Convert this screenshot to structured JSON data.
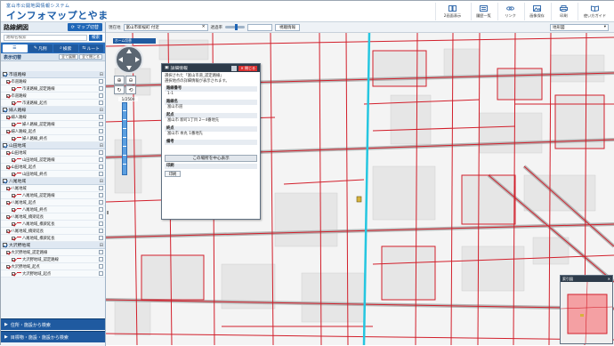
{
  "header": {
    "subtitle": "富山市公開地図情報システム",
    "title": "インフォマップとやま",
    "tools": [
      {
        "label": "2画面表示",
        "icon": "dual-screen-icon"
      },
      {
        "label": "履歴一覧",
        "icon": "history-list-icon"
      },
      {
        "label": "リンク",
        "icon": "link-icon"
      },
      {
        "label": "画像保存",
        "icon": "image-save-icon"
      },
      {
        "label": "印刷",
        "icon": "print-icon"
      },
      {
        "label": "使い方ガイド",
        "icon": "guide-icon"
      }
    ]
  },
  "panel": {
    "title": "路線網図",
    "map_switch": "マップ切替",
    "search_placeholder": "路線名検索",
    "search_button": "検索",
    "tabs": [
      "",
      "凡例",
      "検索",
      "ルート"
    ],
    "layer_bar": {
      "label": "表示切替",
      "btn_open": "全て展開",
      "btn_close": "全て閉じる"
    },
    "groups": [
      {
        "label": "市道路線",
        "checked": true,
        "items": [
          {
            "level": 1,
            "label": "市道路線",
            "checked": true
          },
          {
            "level": 2,
            "label": "市道路線_認定路線",
            "checked": true,
            "color": "#d21f2b"
          },
          {
            "level": 1,
            "label": "市道路線",
            "checked": true
          },
          {
            "level": 2,
            "label": "市道路線_起点",
            "checked": true,
            "color": "#d21f2b"
          }
        ]
      },
      {
        "label": "婦人路線",
        "checked": true,
        "items": [
          {
            "level": 1,
            "label": "婦人路線",
            "checked": true
          },
          {
            "level": 2,
            "label": "婦人路線_認定路線",
            "checked": true,
            "color": "#d21f2b"
          },
          {
            "level": 1,
            "label": "婦人路線_起点",
            "checked": true
          },
          {
            "level": 2,
            "label": "婦人路線_終点",
            "checked": true,
            "color": "#d21f2b"
          }
        ]
      },
      {
        "label": "山田地域",
        "checked": true,
        "items": [
          {
            "level": 1,
            "label": "山田地域",
            "checked": true
          },
          {
            "level": 2,
            "label": "山田地域_認定路線",
            "checked": true,
            "color": "#d21f2b"
          },
          {
            "level": 1,
            "label": "山田地域_起点",
            "checked": true
          },
          {
            "level": 2,
            "label": "山田地域_終点",
            "checked": true,
            "color": "#d21f2b"
          }
        ]
      },
      {
        "label": "八尾地域",
        "checked": true,
        "items": [
          {
            "level": 1,
            "label": "八尾地域",
            "checked": true
          },
          {
            "level": 2,
            "label": "八尾地域_認定路線",
            "checked": true,
            "color": "#d21f2b"
          },
          {
            "level": 1,
            "label": "八尾地域_起点",
            "checked": true
          },
          {
            "level": 2,
            "label": "八尾地域_終点",
            "checked": true,
            "color": "#d21f2b"
          },
          {
            "level": 1,
            "label": "八尾地域_橋梁延長",
            "checked": true
          },
          {
            "level": 2,
            "label": "八尾地域_橋梁延長",
            "checked": true,
            "color": "#d21f2b"
          },
          {
            "level": 1,
            "label": "八尾地域_橋梁延長",
            "checked": true
          },
          {
            "level": 2,
            "label": "八尾地域_橋梁延長",
            "checked": true,
            "color": "#d21f2b"
          }
        ]
      },
      {
        "label": "大沢野地域",
        "checked": true,
        "items": [
          {
            "level": 1,
            "label": "大沢野地域_認定路線",
            "checked": true
          },
          {
            "level": 2,
            "label": "大沢野地域_認定路線",
            "checked": true,
            "color": "#d21f2b"
          },
          {
            "level": 1,
            "label": "大沢野地域_起点",
            "checked": true
          },
          {
            "level": 2,
            "label": "大沢野地域_起点",
            "checked": true,
            "color": "#d21f2b"
          }
        ]
      }
    ],
    "bottom_buttons": [
      "住所・施設から検索",
      "目標物・施設・施設から検索"
    ]
  },
  "map": {
    "address_label": "現在地",
    "address_value": "富山市新桜町 付近",
    "opacity_label": "透過率",
    "view_button": "視聴情報",
    "basemap": "地形図",
    "scale": "1/2500",
    "nav_label": "ホーム切替"
  },
  "popup": {
    "title": "詳細情報",
    "close_label": "閉じる",
    "intro": [
      "選択された「富山市道_認定路線」",
      "選択地点の詳細情報が表示されます。"
    ],
    "route_no_label": "路線番号",
    "route_no": "1-1",
    "route_name_label": "路線名",
    "route_name": "富山市道",
    "start_label": "起点",
    "start": "富山市 新町1丁目 2ー4番地先",
    "end_label": "終点",
    "end": "富山市 本丸 1番地先",
    "remarks_label": "備考",
    "remarks": "",
    "center_button": "この場所を中心表示",
    "print_label": "印刷",
    "print_button": "印刷"
  },
  "overview": {
    "title": "索引図"
  }
}
